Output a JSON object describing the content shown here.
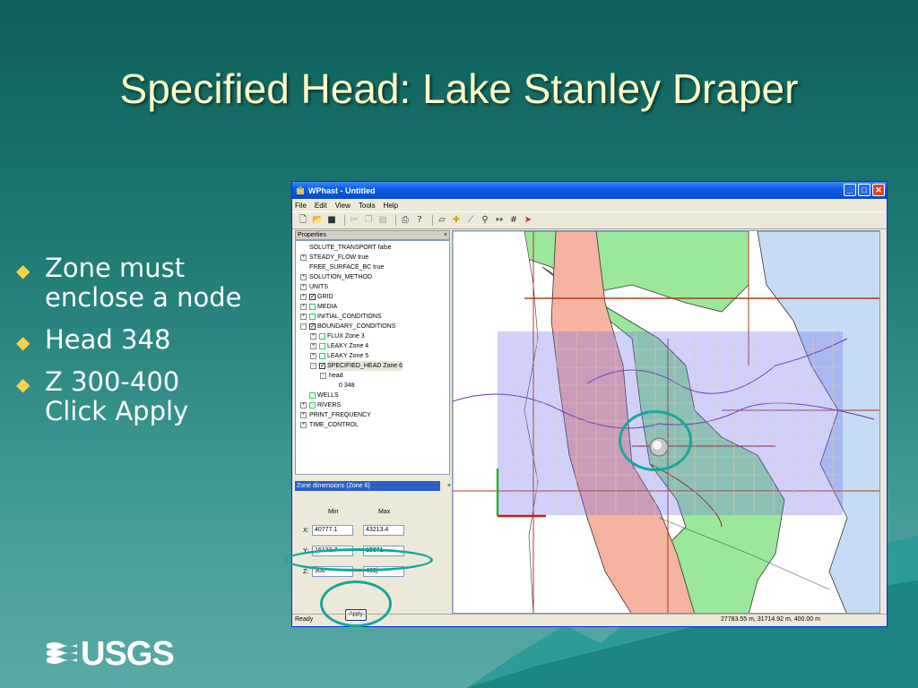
{
  "slide": {
    "title": "Specified Head: Lake Stanley Draper",
    "bullets": [
      {
        "line1": "Zone must",
        "line2": "enclose a node"
      },
      {
        "line1": "Head 348",
        "line2": ""
      },
      {
        "line1": "Z 300-400",
        "line2": "Click Apply"
      }
    ],
    "logo_text": "USGS"
  },
  "window": {
    "title": "WPhast - Untitled",
    "menu": [
      "File",
      "Edit",
      "View",
      "Tools",
      "Help"
    ],
    "properties_label": "Properties",
    "tree": [
      {
        "label": "SOLUTE_TRANSPORT false",
        "indent": 0,
        "expander": "",
        "checkbox": ""
      },
      {
        "label": "STEADY_FLOW true",
        "indent": 0,
        "expander": "+",
        "checkbox": ""
      },
      {
        "label": "FREE_SURFACE_BC true",
        "indent": 0,
        "expander": "",
        "checkbox": ""
      },
      {
        "label": "SOLUTION_METHOD",
        "indent": 0,
        "expander": "+",
        "checkbox": ""
      },
      {
        "label": "UNITS",
        "indent": 0,
        "expander": "+",
        "checkbox": ""
      },
      {
        "label": "GRID",
        "indent": 0,
        "expander": "+",
        "checkbox": "on"
      },
      {
        "label": "MEDIA",
        "indent": 0,
        "expander": "+",
        "checkbox": "off"
      },
      {
        "label": "INITIAL_CONDITIONS",
        "indent": 0,
        "expander": "+",
        "checkbox": "off"
      },
      {
        "label": "BOUNDARY_CONDITIONS",
        "indent": 0,
        "expander": "-",
        "checkbox": "on"
      },
      {
        "label": "FLUX Zone 3",
        "indent": 1,
        "expander": "+",
        "checkbox": "off"
      },
      {
        "label": "LEAKY Zone 4",
        "indent": 1,
        "expander": "+",
        "checkbox": "off"
      },
      {
        "label": "LEAKY Zone 5",
        "indent": 1,
        "expander": "+",
        "checkbox": "off"
      },
      {
        "label": "SPECIFIED_HEAD Zone 6",
        "indent": 1,
        "expander": "-",
        "checkbox": "on"
      },
      {
        "label": "head",
        "indent": 2,
        "expander": "-",
        "checkbox": ""
      },
      {
        "label": "0 348",
        "indent": 3,
        "expander": "",
        "checkbox": ""
      },
      {
        "label": "WELLS",
        "indent": 0,
        "expander": "",
        "checkbox": "off"
      },
      {
        "label": "RIVERS",
        "indent": 0,
        "expander": "+",
        "checkbox": "off"
      },
      {
        "label": "PRINT_FREQUENCY",
        "indent": 0,
        "expander": "+",
        "checkbox": ""
      },
      {
        "label": "TIME_CONTROL",
        "indent": 0,
        "expander": "+",
        "checkbox": ""
      }
    ],
    "dims": {
      "header": "Zone dimensions (Zone 6)",
      "min_label": "Min",
      "max_label": "Max",
      "x_label": "X:",
      "y_label": "Y:",
      "z_label": "Z:",
      "x_min": "40777.1",
      "x_max": "43213.4",
      "y_min": "16122.7",
      "y_max": "19371",
      "z_min": "300",
      "z_max": "400|",
      "apply_label": "Apply"
    },
    "status": {
      "left": "Ready",
      "right": "27783.55 m, 31714.92 m, 400.00 m"
    }
  },
  "colors": {
    "highlight_ring": "#17a89a",
    "title_text": "#ffffc8",
    "bullet_mark": "#ffd24a"
  }
}
